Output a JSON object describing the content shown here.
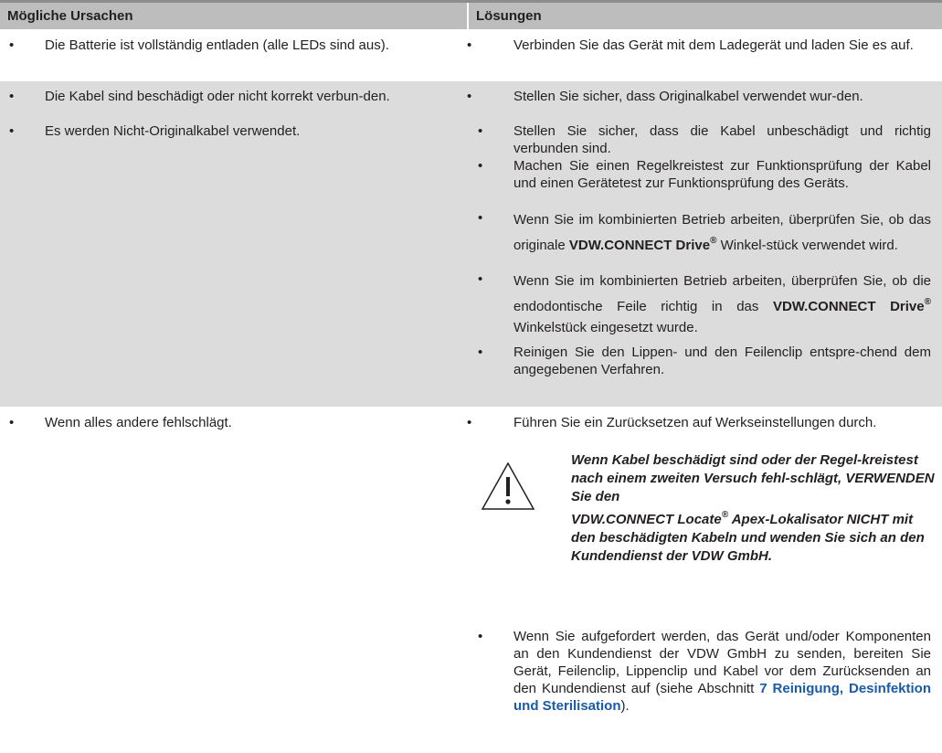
{
  "header": {
    "col1": "Mögliche Ursachen",
    "col2": "Lösungen"
  },
  "bullet": "•",
  "rows": [
    {
      "causes": [
        "Die Batterie ist vollständig entladen (alle LEDs sind aus)."
      ],
      "solutions": [
        "Verbinden Sie das Gerät mit dem Ladegerät und laden Sie es auf."
      ]
    },
    {
      "causes": [
        "Die Kabel sind beschädigt oder nicht korrekt verbun-den.",
        "Es werden Nicht-Originalkabel verwendet."
      ],
      "solutions": [
        "Stellen Sie sicher, dass Originalkabel verwendet wur-den.",
        "Stellen Sie sicher, dass die Kabel unbeschädigt und richtig verbunden sind.",
        "Machen Sie einen Regelkreistest zur Funktionsprüfung der Kabel und einen Gerätetest zur Funktionsprüfung des Geräts.",
        {
          "pre": "Wenn Sie im kombinierten Betrieb arbeiten, überprüfen Sie, ob das originale ",
          "brand": "VDW.CONNECT Drive",
          "reg": "®",
          "post": " Winkel-stück verwendet wird."
        },
        {
          "pre": "Wenn Sie im kombinierten Betrieb arbeiten, überprüfen Sie, ob die endodontische Feile richtig in das ",
          "brand": "VDW.CONNECT Drive",
          "reg": "®",
          "post": " Winkelstück eingesetzt wurde."
        },
        "Reinigen Sie den Lippen- und den Feilenclip entspre-chend dem angegebenen Verfahren."
      ]
    },
    {
      "causes": [
        "Wenn alles andere fehlschlägt."
      ],
      "solutions": [
        "Führen Sie ein Zurücksetzen auf Werkseinstellungen durch."
      ],
      "warning": {
        "line1": "Wenn Kabel beschädigt sind oder der Regel-kreistest nach einem zweiten Versuch fehl-schlägt, VERWENDEN Sie den",
        "brand": "VDW.CONNECT Locate",
        "reg": "®",
        "line2": " Apex-Lokalisator NICHT mit den beschädigten Kabeln und wenden Sie sich an den Kundendienst der VDW GmbH."
      },
      "final": {
        "pre": "Wenn Sie aufgefordert werden, das Gerät und/oder Komponenten an den Kundendienst der VDW GmbH zu senden, bereiten Sie Gerät, Feilenclip, Lippenclip und Kabel vor dem Zurücksenden an den Kundendienst auf (siehe Abschnitt ",
        "link": "7 Reinigung, Desinfektion und Sterilisation",
        "post": ")."
      }
    }
  ]
}
